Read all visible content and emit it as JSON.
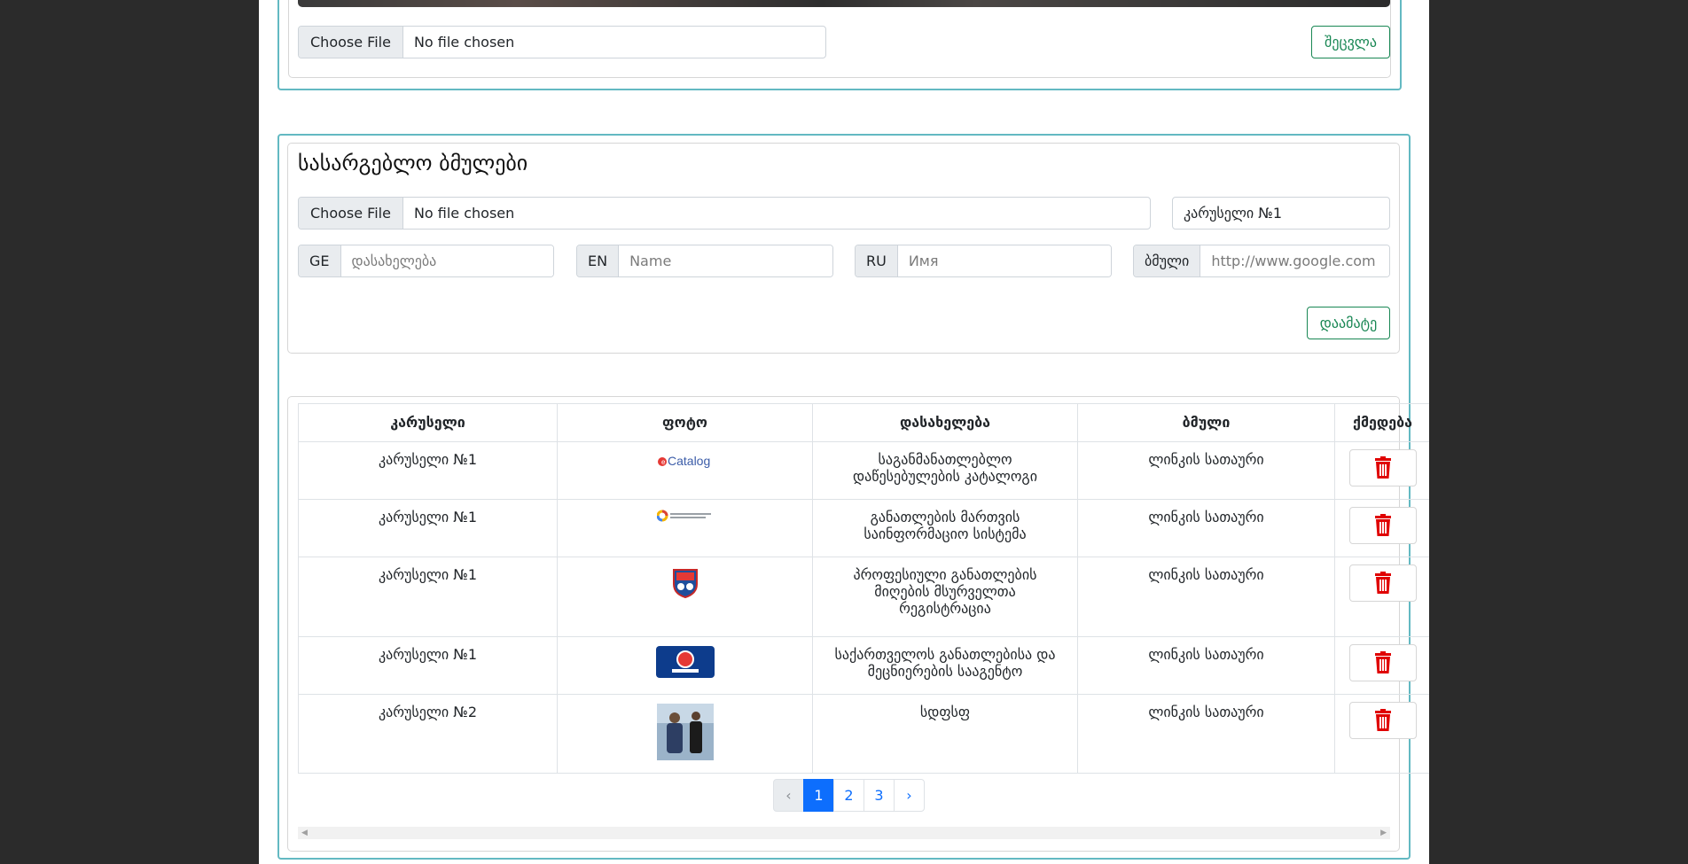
{
  "top_section": {
    "file_button": "Choose File",
    "file_status": "No file chosen",
    "change_button": "შეცვლა"
  },
  "useful_links": {
    "title": "სასარგებლო ბმულები",
    "file_button": "Choose File",
    "file_status": "No file chosen",
    "carousel_select": "კარუსელი №1",
    "fields": {
      "ge_label": "GE",
      "ge_placeholder": "დასახელება",
      "en_label": "EN",
      "en_placeholder": "Name",
      "ru_label": "RU",
      "ru_placeholder": "Имя",
      "link_label": "ბმული",
      "link_placeholder": "http://www.google.com"
    },
    "add_button": "დაამატე"
  },
  "table": {
    "headers": [
      "კარუსელი",
      "ფოტო",
      "დასახელება",
      "ბმული",
      "ქმედება"
    ],
    "rows": [
      {
        "carousel": "კარუსელი №1",
        "photo_icon": "ecatalog-logo",
        "name": [
          "საგანმანათლებლო",
          "დაწესებულების კატალოგი"
        ],
        "link": "ლინკის სათაური"
      },
      {
        "carousel": "კარუსელი №1",
        "photo_icon": "emis-logo",
        "name": [
          "განათლების მართვის",
          "საინფორმაციო სისტემა"
        ],
        "link": "ლინკის სათაური"
      },
      {
        "carousel": "კარუსელი №1",
        "photo_icon": "crest-logo",
        "name": [
          "პროფესიული განათლების",
          "მიღების მსურველთა",
          "რეგისტრაცია"
        ],
        "link": "ლინკის სათაური"
      },
      {
        "carousel": "კარუსელი №1",
        "photo_icon": "naec-logo",
        "name": [
          "საქართველოს განათლებისა და",
          "მეცნიერების სააგენტო"
        ],
        "link": "ლინკის სათაური"
      },
      {
        "carousel": "კარუსელი №2",
        "photo_icon": "people-photo",
        "name": [
          "სდფსფ"
        ],
        "link": "ლინკის სათაური"
      }
    ],
    "logo_text": "Catalog"
  },
  "pagination": {
    "prev": "‹",
    "pages": [
      "1",
      "2",
      "3"
    ],
    "active": "1",
    "next": "›"
  },
  "colors": {
    "accent_border": "#63b9c2",
    "success": "#198754",
    "danger": "#e00000",
    "primary": "#0d6efd"
  }
}
